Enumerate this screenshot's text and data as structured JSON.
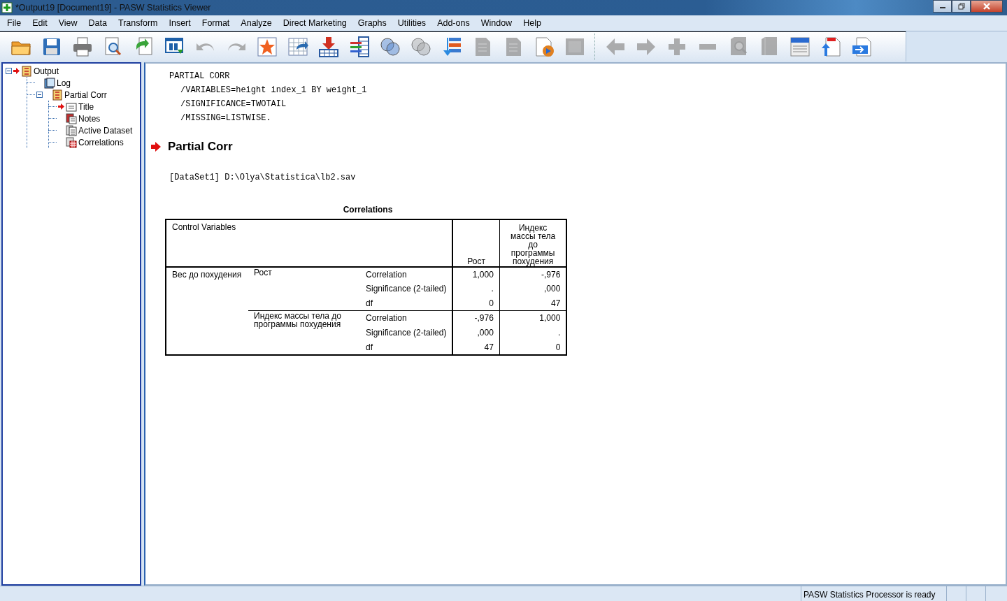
{
  "window": {
    "title": "*Output19 [Document19] - PASW Statistics Viewer"
  },
  "menu": [
    "File",
    "Edit",
    "View",
    "Data",
    "Transform",
    "Insert",
    "Format",
    "Analyze",
    "Direct Marketing",
    "Graphs",
    "Utilities",
    "Add-ons",
    "Window",
    "Help"
  ],
  "toolbar": [
    {
      "kind": "folder",
      "disabled": false
    },
    {
      "kind": "disk",
      "disabled": false
    },
    {
      "kind": "printer",
      "disabled": false
    },
    {
      "kind": "preview",
      "disabled": false
    },
    {
      "kind": "export",
      "disabled": false
    },
    {
      "kind": "recall",
      "disabled": false
    },
    {
      "kind": "undo",
      "disabled": true
    },
    {
      "kind": "redo",
      "disabled": true
    },
    {
      "kind": "star",
      "disabled": false
    },
    {
      "kind": "goto",
      "disabled": false
    },
    {
      "kind": "insert",
      "disabled": false
    },
    {
      "kind": "variables",
      "disabled": false
    },
    {
      "kind": "circles",
      "disabled": false
    },
    {
      "kind": "circles",
      "disabled": true
    },
    {
      "kind": "list",
      "disabled": false
    },
    {
      "kind": "page",
      "disabled": true
    },
    {
      "kind": "page",
      "disabled": true
    },
    {
      "kind": "script",
      "disabled": false
    },
    {
      "kind": "frame",
      "disabled": true
    },
    {
      "kind": "left",
      "disabled": true
    },
    {
      "kind": "right",
      "disabled": true
    },
    {
      "kind": "plus",
      "disabled": true
    },
    {
      "kind": "minus",
      "disabled": true
    },
    {
      "kind": "zoombook",
      "disabled": true
    },
    {
      "kind": "book",
      "disabled": true
    },
    {
      "kind": "window",
      "disabled": false
    },
    {
      "kind": "docup",
      "disabled": false
    },
    {
      "kind": "docright",
      "disabled": false
    }
  ],
  "outline": [
    {
      "label": "Output",
      "kind": "folder",
      "current": true,
      "expanded": true,
      "children": [
        {
          "label": "Log",
          "kind": "log",
          "current": false
        },
        {
          "label": "Partial Corr",
          "kind": "folder",
          "current": false,
          "expanded": true,
          "children": [
            {
              "label": "Title",
              "kind": "title",
              "current": true
            },
            {
              "label": "Notes",
              "kind": "notes",
              "current": false
            },
            {
              "label": "Active Dataset",
              "kind": "doc",
              "current": false
            },
            {
              "label": "Correlations",
              "kind": "table",
              "current": false
            }
          ]
        }
      ]
    }
  ],
  "syntax": {
    "command": "PARTIAL CORR",
    "subcommands": [
      "/VARIABLES=height index_1 BY weight_1",
      "/SIGNIFICANCE=TWOTAIL",
      "/MISSING=LISTWISE."
    ]
  },
  "heading": {
    "text": "Partial Corr",
    "current": true
  },
  "dataset": "[DataSet1] D:\\Olya\\Statistica\\lb2.sav",
  "table": {
    "title": "Correlations",
    "corner": "Control Variables",
    "columns": [
      "Рост",
      "Индекс массы тела до программы похудения"
    ],
    "groups": [
      {
        "control": "Вес до похудения",
        "variables": [
          {
            "name": "Рост",
            "stats": [
              {
                "label": "Correlation",
                "values": [
                  "1,000",
                  "-,976"
                ]
              },
              {
                "label": "Significance (2-tailed)",
                "values": [
                  ".",
                  ",000"
                ]
              },
              {
                "label": "df",
                "values": [
                  "0",
                  "47"
                ]
              }
            ]
          },
          {
            "name": "Индекс массы тела до программы похудения",
            "stats": [
              {
                "label": "Correlation",
                "values": [
                  "-,976",
                  "1,000"
                ]
              },
              {
                "label": "Significance (2-tailed)",
                "values": [
                  ",000",
                  "."
                ]
              },
              {
                "label": "df",
                "values": [
                  "47",
                  "0"
                ]
              }
            ]
          }
        ]
      }
    ]
  },
  "status_bar": {
    "message": "PASW Statistics Processor is ready"
  }
}
